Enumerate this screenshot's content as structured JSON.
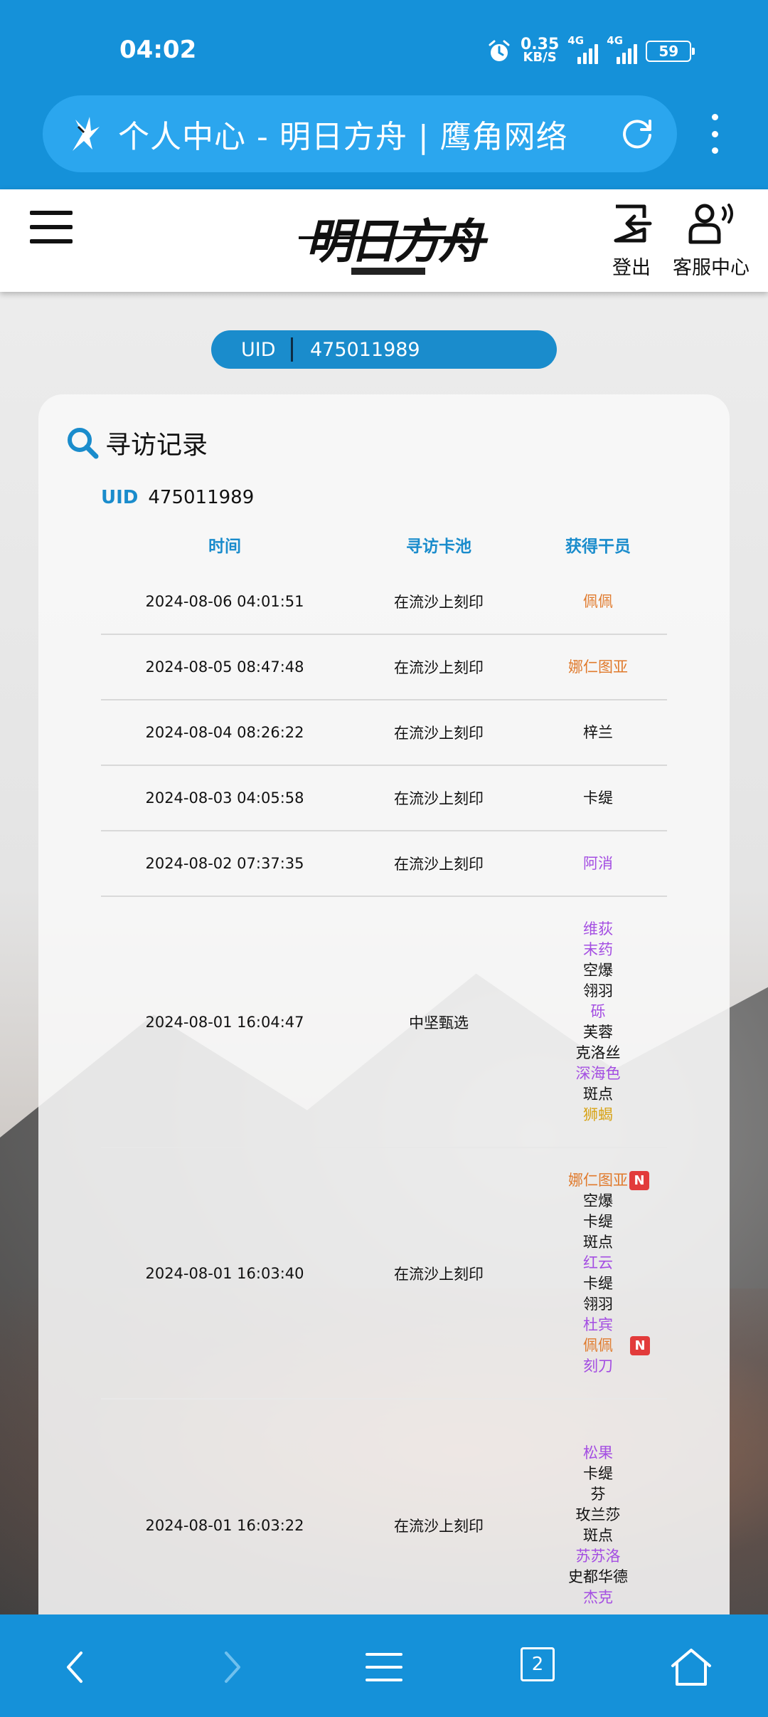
{
  "status_bar": {
    "time": "04:02",
    "net_speed_value": "0.35",
    "net_speed_unit": "KB/S",
    "signal1_label": "4G",
    "signal2_label": "4G",
    "battery": "59"
  },
  "browser": {
    "tab_title": "个人中心 - 明日方舟 | 鹰角网络"
  },
  "header": {
    "logo_text": "明日方舟",
    "logout_label": "登出",
    "service_label": "客服中心"
  },
  "uid_pill": {
    "label": "UID",
    "value": "475011989"
  },
  "card": {
    "title": "寻访记录",
    "uid_label": "UID",
    "uid_value": "475011989",
    "columns": [
      "时间",
      "寻访卡池",
      "获得干员"
    ],
    "rows": [
      {
        "time": "2024-08-06 04:01:51",
        "pool": "在流沙上刻印",
        "operators": [
          {
            "name": "佩佩",
            "rarity": 6
          }
        ]
      },
      {
        "time": "2024-08-05 08:47:48",
        "pool": "在流沙上刻印",
        "operators": [
          {
            "name": "娜仁图亚",
            "rarity": 6
          }
        ]
      },
      {
        "time": "2024-08-04 08:26:22",
        "pool": "在流沙上刻印",
        "operators": [
          {
            "name": "梓兰",
            "rarity": 3
          }
        ]
      },
      {
        "time": "2024-08-03 04:05:58",
        "pool": "在流沙上刻印",
        "operators": [
          {
            "name": "卡缇",
            "rarity": 3
          }
        ]
      },
      {
        "time": "2024-08-02 07:37:35",
        "pool": "在流沙上刻印",
        "operators": [
          {
            "name": "阿消",
            "rarity": 4
          }
        ]
      },
      {
        "time": "2024-08-01 16:04:47",
        "pool": "中坚甄选",
        "operators": [
          {
            "name": "维荻",
            "rarity": 4
          },
          {
            "name": "末药",
            "rarity": 4
          },
          {
            "name": "空爆",
            "rarity": 3
          },
          {
            "name": "翎羽",
            "rarity": 3
          },
          {
            "name": "砾",
            "rarity": 4
          },
          {
            "name": "芙蓉",
            "rarity": 3
          },
          {
            "name": "克洛丝",
            "rarity": 3
          },
          {
            "name": "深海色",
            "rarity": 4
          },
          {
            "name": "斑点",
            "rarity": 3
          },
          {
            "name": "狮蝎",
            "rarity": 5
          }
        ]
      },
      {
        "time": "2024-08-01 16:03:40",
        "pool": "在流沙上刻印",
        "operators": [
          {
            "name": "娜仁图亚",
            "rarity": 6,
            "new": "N"
          },
          {
            "name": "空爆",
            "rarity": 3
          },
          {
            "name": "卡缇",
            "rarity": 3
          },
          {
            "name": "斑点",
            "rarity": 3
          },
          {
            "name": "红云",
            "rarity": 4
          },
          {
            "name": "卡缇",
            "rarity": 3
          },
          {
            "name": "翎羽",
            "rarity": 3
          },
          {
            "name": "杜宾",
            "rarity": 4
          },
          {
            "name": "佩佩",
            "rarity": 6,
            "new": "N",
            "new_far": true
          },
          {
            "name": "刻刀",
            "rarity": 4
          }
        ]
      },
      {
        "time": "2024-08-01 16:03:22",
        "pool": "在流沙上刻印",
        "operators": [
          {
            "name": "松果",
            "rarity": 4
          },
          {
            "name": "卡缇",
            "rarity": 3
          },
          {
            "name": "芬",
            "rarity": 3
          },
          {
            "name": "玫兰莎",
            "rarity": 3
          },
          {
            "name": "斑点",
            "rarity": 3
          },
          {
            "name": "苏苏洛",
            "rarity": 4
          },
          {
            "name": "史都华德",
            "rarity": 3
          },
          {
            "name": "杰克",
            "rarity": 4
          }
        ]
      }
    ]
  },
  "bottom_nav": {
    "tab_count": "2"
  },
  "colors": {
    "browser_blue": "#1591d9",
    "accent": "#1a8ccc",
    "rarity6": "#e07a2c",
    "rarity5": "#d7a317",
    "rarity4": "#a44ee2",
    "rarity3": "#111111",
    "new_badge": "#e23b3b"
  },
  "icons": {
    "alarm": "alarm-icon",
    "reload": "reload-icon",
    "menu": "hamburger-icon",
    "logout": "logout-icon",
    "service": "customer-service-icon",
    "search": "search-icon",
    "back": "back-icon",
    "forward": "forward-icon",
    "browser_menu": "menu-lines-icon",
    "home": "home-icon"
  }
}
